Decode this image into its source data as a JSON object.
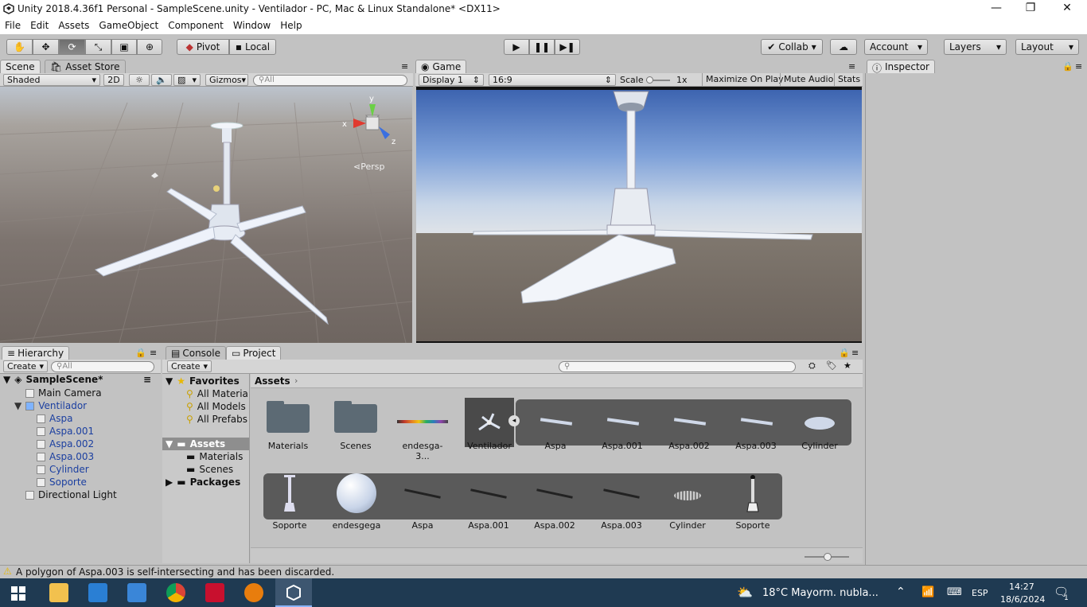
{
  "window": {
    "title": "Unity 2018.4.36f1 Personal - SampleScene.unity - Ventilador - PC, Mac & Linux Standalone* <DX11>"
  },
  "menu": [
    "File",
    "Edit",
    "Assets",
    "GameObject",
    "Component",
    "Window",
    "Help"
  ],
  "toolbar": {
    "pivot": "Pivot",
    "local": "Local",
    "collab": "Collab",
    "account": "Account",
    "layers": "Layers",
    "layout": "Layout"
  },
  "scene_panel": {
    "tab_scene": "Scene",
    "tab_store": "Asset Store",
    "shading": "Shaded",
    "mode2d": "2D",
    "gizmos": "Gizmos",
    "search_placeholder": "All",
    "persp": "Persp",
    "axis_x": "x",
    "axis_y": "y",
    "axis_z": "z"
  },
  "game_panel": {
    "tab": "Game",
    "display": "Display 1",
    "aspect": "16:9",
    "scale_label": "Scale",
    "scale_value": "1x",
    "maximize": "Maximize On Play",
    "mute": "Mute Audio",
    "stats": "Stats"
  },
  "inspector": {
    "tab": "Inspector"
  },
  "hierarchy": {
    "tab": "Hierarchy",
    "create": "Create",
    "search_placeholder": "All",
    "scene": "SampleScene*",
    "items": [
      "Main Camera",
      "Ventilador",
      "Aspa",
      "Aspa.001",
      "Aspa.002",
      "Aspa.003",
      "Cylinder",
      "Soporte",
      "Directional Light"
    ]
  },
  "project": {
    "tab_console": "Console",
    "tab_project": "Project",
    "create": "Create",
    "favorites": "Favorites",
    "fav_items": [
      "All Materia",
      "All Models",
      "All Prefabs"
    ],
    "assets_root": "Assets",
    "asset_folders": [
      "Materials",
      "Scenes"
    ],
    "packages": "Packages",
    "breadcrumb": "Assets",
    "row1": [
      "Materials",
      "Scenes",
      "endesga-3...",
      "Ventilador",
      "Aspa",
      "Aspa.001",
      "Aspa.002",
      "Aspa.003",
      "Cylinder"
    ],
    "row2": [
      "Soporte",
      "endesgega",
      "Aspa",
      "Aspa.001",
      "Aspa.002",
      "Aspa.003",
      "Cylinder",
      "Soporte"
    ]
  },
  "status": {
    "message": "A polygon of Aspa.003 is self-intersecting and has been discarded."
  },
  "taskbar": {
    "weather": "18°C  Mayorm. nubla...",
    "lang": "ESP",
    "time": "14:27",
    "date": "18/6/2024",
    "notif_count": "1"
  },
  "colors": {
    "accent": "#3a72d6",
    "selected": "#3e7de0",
    "warning": "#e8b800"
  }
}
